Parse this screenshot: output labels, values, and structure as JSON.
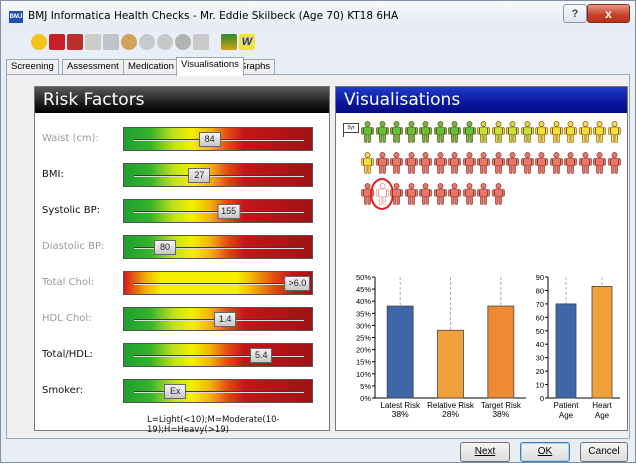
{
  "window": {
    "title": "BMJ Informatica Health Checks - Mr. Eddie Skilbeck (Age 70) KT18 6HA",
    "app_icon_text": "BMJ",
    "help_button": "?",
    "close_button": "x"
  },
  "toolbar": {
    "icons": [
      "smiley-icon",
      "calendar-icon",
      "printer-icon",
      "pen-icon",
      "hand-icon",
      "person-icon",
      "globe-icon",
      "gear-icon",
      "ball-icon",
      "person-dropdown-icon",
      "chart-icon",
      "word-icon"
    ]
  },
  "tabs": [
    {
      "label": "Screening",
      "active": false
    },
    {
      "label": "Assessment",
      "active": false
    },
    {
      "label": "Medication",
      "active": false
    },
    {
      "label": "Visualisations",
      "active": true
    },
    {
      "label": "Graphs",
      "active": false
    }
  ],
  "risk_factors": {
    "header": "Risk Factors",
    "rows": [
      {
        "label": "Waist (cm):",
        "value": "84",
        "position_fraction": 0.44,
        "style": "dim",
        "bar": "standard"
      },
      {
        "label": "BMI:",
        "value": "27",
        "position_fraction": 0.38,
        "style": "dark",
        "bar": "standard"
      },
      {
        "label": "Systolic BP:",
        "value": "155",
        "position_fraction": 0.55,
        "style": "dark",
        "bar": "standard"
      },
      {
        "label": "Diastolic BP:",
        "value": "80",
        "position_fraction": 0.18,
        "style": "dim",
        "bar": "standard"
      },
      {
        "label": "Total Chol:",
        "value": ">6.0",
        "position_fraction": 0.95,
        "style": "dim",
        "bar": "chol"
      },
      {
        "label": "HDL Chol:",
        "value": "1.4",
        "position_fraction": 0.53,
        "style": "dim",
        "bar": "standard"
      },
      {
        "label": "Total/HDL:",
        "value": "5.4",
        "position_fraction": 0.74,
        "style": "dark",
        "bar": "standard"
      },
      {
        "label": "Smoker:",
        "value": "Ex",
        "position_fraction": 0.24,
        "style": "dark",
        "bar": "standard"
      }
    ],
    "smoker_note": "L=Light(<10);M=Moderate(10-19);H=Heavy(>19)"
  },
  "visualisations": {
    "header": "Visualisations",
    "flag_text": "5yr",
    "people": {
      "total": 46,
      "green": 8,
      "yellow": 11,
      "red": 27,
      "highlighted_index": 37
    }
  },
  "chart_data": [
    {
      "type": "bar",
      "categories": [
        "Latest Risk",
        "Relative Risk",
        "Target Risk"
      ],
      "values": [
        38,
        28,
        38
      ],
      "value_labels": [
        "38%",
        "28%",
        "38%"
      ],
      "colors": [
        "#3f67a8",
        "#f0a13c",
        "#ee8a33"
      ],
      "ylim": [
        0,
        50
      ],
      "yticks": [
        "0%",
        "5%",
        "10%",
        "15%",
        "20%",
        "25%",
        "30%",
        "35%",
        "40%",
        "45%",
        "50%"
      ],
      "grid": false
    },
    {
      "type": "bar",
      "categories": [
        "Patient Age",
        "Heart Age"
      ],
      "category_lines": [
        [
          "Patient",
          "Age"
        ],
        [
          "Heart",
          "Age"
        ]
      ],
      "values": [
        70,
        83
      ],
      "colors": [
        "#3f67a8",
        "#f0a13c"
      ],
      "ylim": [
        0,
        90
      ],
      "yticks": [
        "0",
        "10",
        "20",
        "30",
        "40",
        "50",
        "60",
        "70",
        "80",
        "90"
      ],
      "grid": false
    }
  ],
  "buttons": {
    "next": "Next",
    "ok": "OK",
    "cancel": "Cancel"
  }
}
